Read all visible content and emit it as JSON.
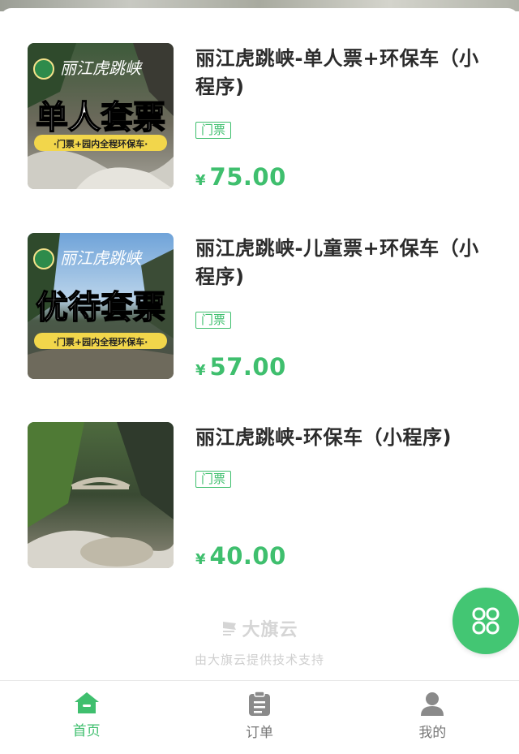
{
  "products": [
    {
      "title": "丽江虎跳峡-单人票+环保车（小程序)",
      "tag": "门票",
      "currency": "¥",
      "price": "75.00",
      "poster": {
        "brand": "丽江虎跳峡",
        "headline": "单人套票",
        "banner": "·门票+园内全程环保车·"
      }
    },
    {
      "title": "丽江虎跳峡-儿童票+环保车（小程序)",
      "tag": "门票",
      "currency": "¥",
      "price": "57.00",
      "poster": {
        "brand": "丽江虎跳峡",
        "headline": "优待套票",
        "banner": "·门票+园内全程环保车·"
      }
    },
    {
      "title": "丽江虎跳峡-环保车（小程序)",
      "tag": "门票",
      "currency": "¥",
      "price": "40.00"
    }
  ],
  "footer": {
    "brand": "大旗云",
    "powered_by": "由大旗云提供技术支持"
  },
  "tabs": [
    {
      "label": "首页",
      "icon": "home-icon",
      "active": true
    },
    {
      "label": "订单",
      "icon": "clipboard-icon",
      "active": false
    },
    {
      "label": "我的",
      "icon": "user-icon",
      "active": false
    }
  ],
  "theme": {
    "accent": "#3fbf6e",
    "fab": "#43c673"
  }
}
